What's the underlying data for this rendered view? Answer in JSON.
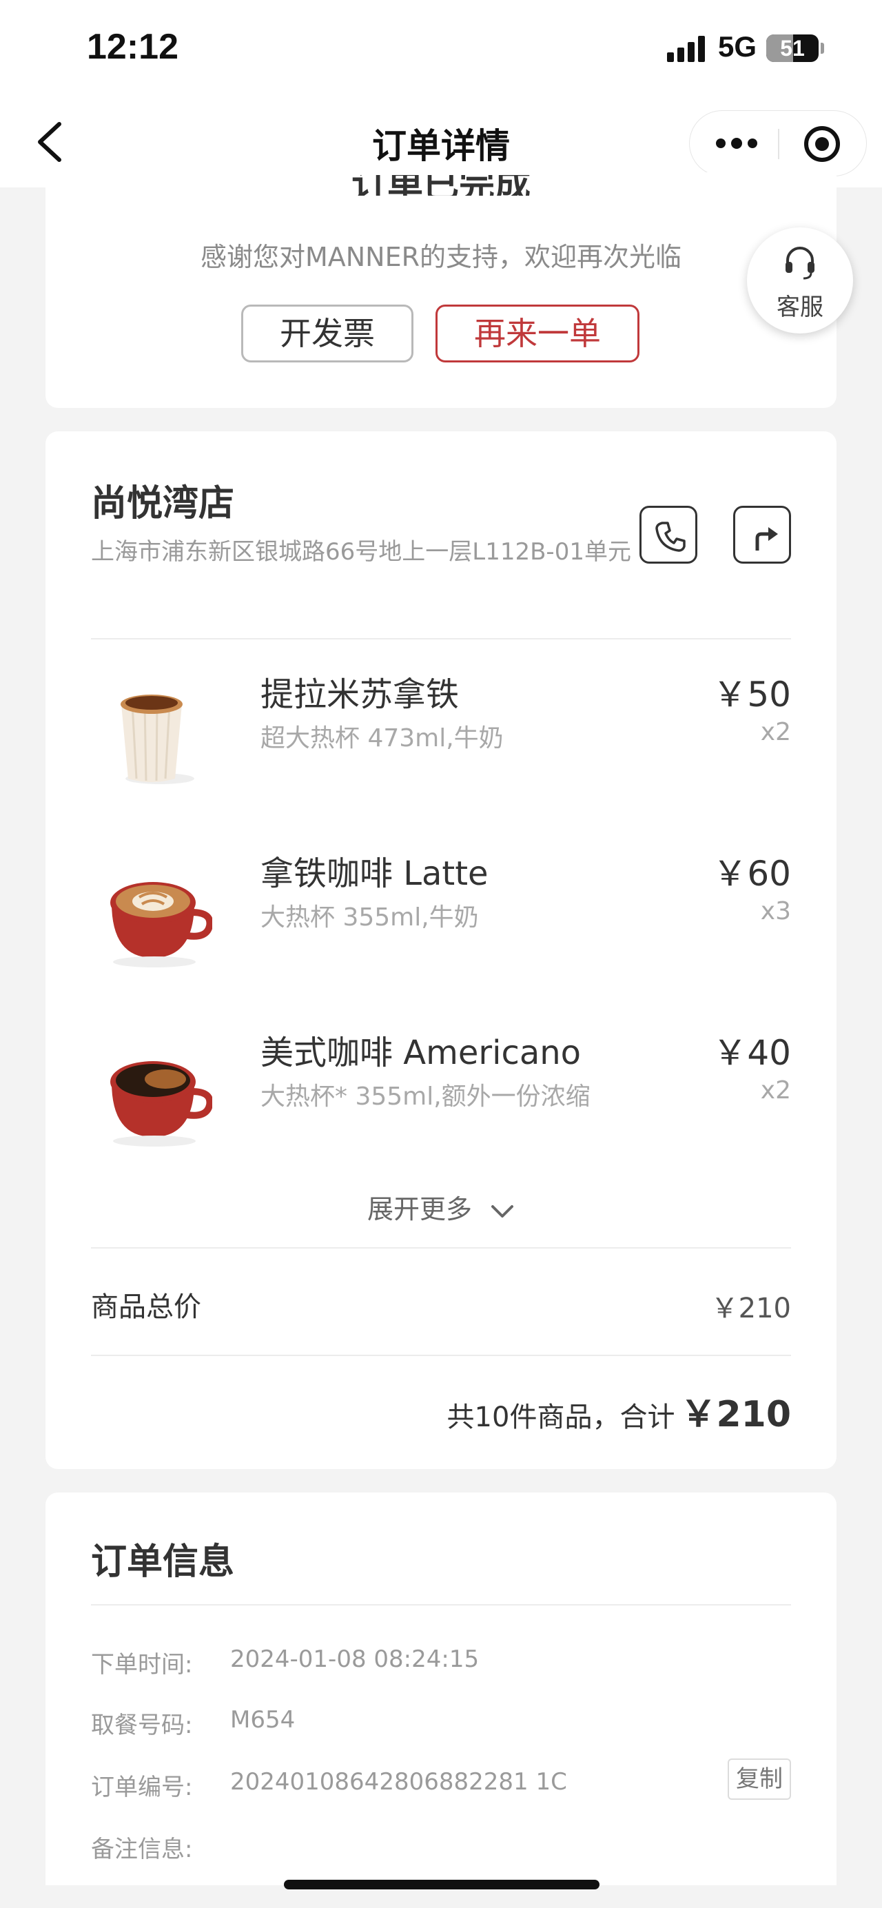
{
  "status_bar": {
    "time": "12:12",
    "network": "5G",
    "battery": "51",
    "battery_level_percent": 51
  },
  "nav": {
    "title": "订单详情",
    "icons": [
      "back-icon",
      "more-icon",
      "close-mini-program-icon"
    ]
  },
  "status_card": {
    "title": "订单已完成",
    "thanks": "感谢您对MANNER的支持，欢迎再次光临",
    "invoice_button": "开发票",
    "reorder_button": "再来一单"
  },
  "service": {
    "label": "客服",
    "icon": "headset-icon"
  },
  "store": {
    "name": "尚悦湾店",
    "address": "上海市浦东新区银城路66号地上一层L112B-01单元",
    "icons": [
      "phone-icon",
      "navigation-icon"
    ]
  },
  "products": [
    {
      "name": "提拉米苏拿铁",
      "spec": "超大热杯 473ml,牛奶",
      "price": "￥50",
      "qty": "x2",
      "image": "paper-cup-tiramisu-latte"
    },
    {
      "name": "拿铁咖啡 Latte",
      "spec": "大热杯 355ml,牛奶",
      "price": "￥60",
      "qty": "x3",
      "image": "red-cup-latte-art"
    },
    {
      "name": "美式咖啡 Americano",
      "spec": "大热杯* 355ml,额外一份浓缩",
      "price": "￥40",
      "qty": "x2",
      "image": "red-cup-americano"
    }
  ],
  "expand_more": "展开更多",
  "totals": {
    "goods_total_label": "商品总价",
    "goods_total_value": "￥210",
    "summary_text": "共10件商品，合计",
    "summary_amount": "￥210"
  },
  "order_info": {
    "title": "订单信息",
    "rows": [
      {
        "label": "下单时间:",
        "value": "2024-01-08 08:24:15"
      },
      {
        "label": "取餐号码:",
        "value": "M654"
      },
      {
        "label": "订单编号:",
        "value": "20240108642806882281 1C"
      },
      {
        "label": "备注信息:",
        "value": ""
      }
    ],
    "copy_button": "复制"
  },
  "colors": {
    "accent_red": "#c0393b",
    "background": "#f3f3f3",
    "card": "#ffffff"
  }
}
